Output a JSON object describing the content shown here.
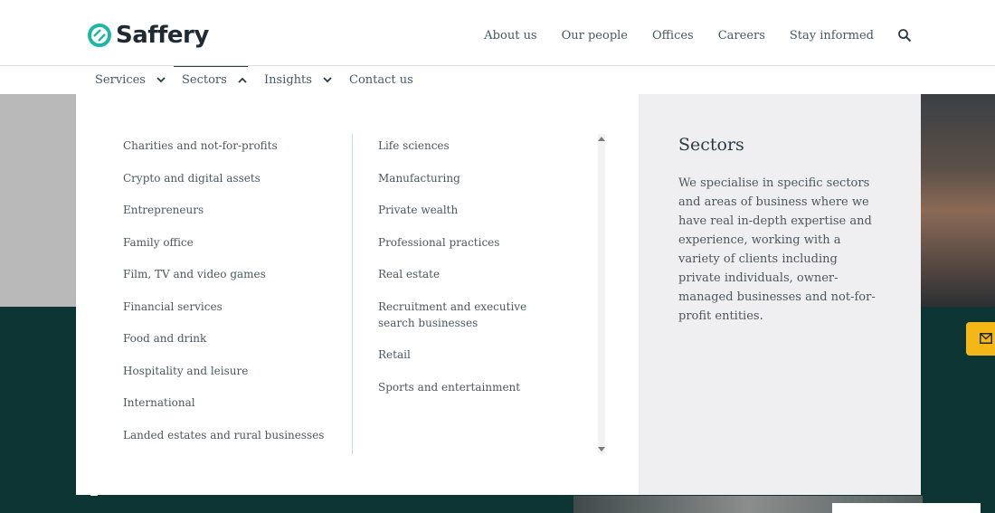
{
  "brand": {
    "name": "Saffery",
    "logo_color": "#1fb6a6"
  },
  "top_nav": {
    "items": [
      "About us",
      "Our people",
      "Offices",
      "Careers",
      "Stay informed"
    ],
    "search_icon": "search-icon"
  },
  "sub_nav": {
    "items": [
      {
        "label": "Services",
        "state": "collapsed"
      },
      {
        "label": "Sectors",
        "state": "expanded"
      },
      {
        "label": "Insights",
        "state": "collapsed"
      },
      {
        "label": "Contact us",
        "state": "none"
      }
    ]
  },
  "sectors_menu": {
    "column1": [
      "Charities and not-for-profits",
      "Crypto and digital assets",
      "Entrepreneurs",
      "Family office",
      "Film, TV and video games",
      "Financial services",
      "Food and drink",
      "Hospitality and leisure",
      "International",
      "Landed estates and rural businesses"
    ],
    "column2": [
      "Life sciences",
      "Manufacturing",
      "Private wealth",
      "Professional practices",
      "Real estate",
      "Recruitment and executive search businesses",
      "Retail",
      "Sports and entertainment"
    ]
  },
  "info_panel": {
    "title": "Sectors",
    "text": "We specialise in specific sectors and areas of business where we have real in-depth expertise and experience, working with a variety of clients including private individuals, owner-managed businesses and not-for-profit entities."
  },
  "floating": {
    "mail_icon": "mail-icon",
    "color": "#f5b715"
  }
}
